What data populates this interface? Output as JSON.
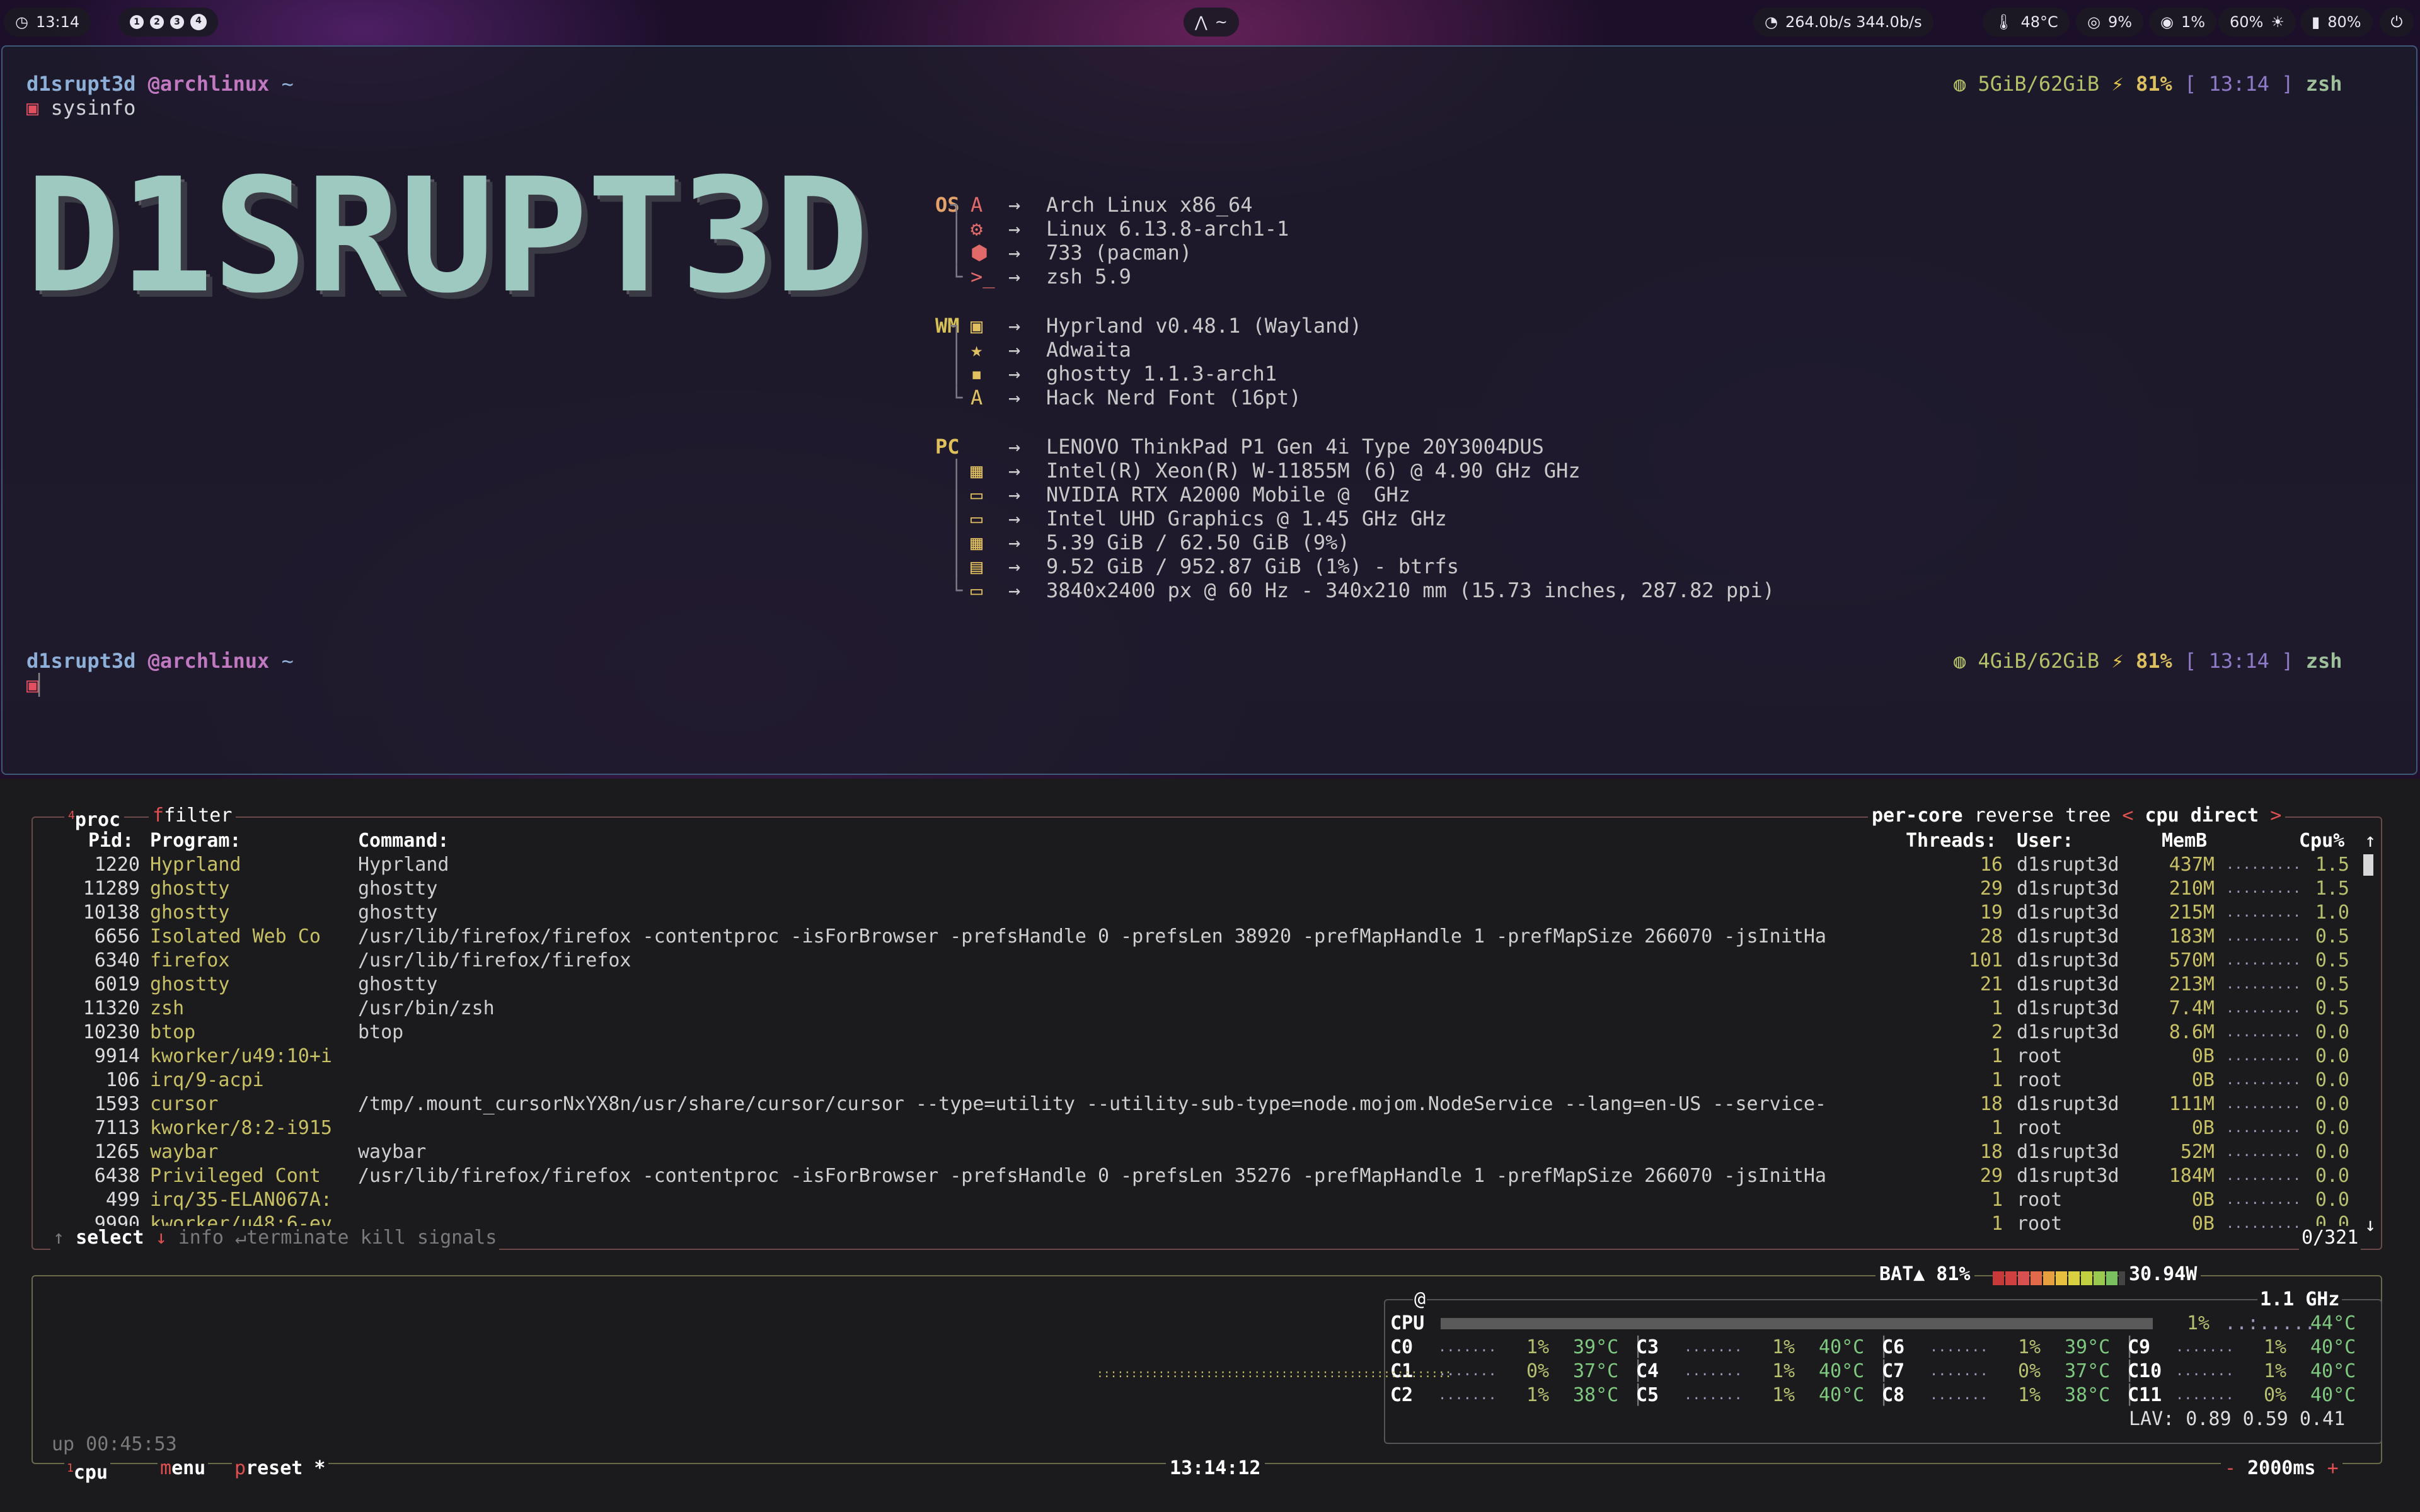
{
  "waybar": {
    "clock": "13:14",
    "workspaces": [
      "1",
      "2",
      "3",
      "4"
    ],
    "launcher": "~",
    "net": "264.0b/s 344.0b/s",
    "temp": "48°C",
    "cpu": "9%",
    "mem": "1%",
    "brightness": "60%",
    "battery": "80%"
  },
  "terminal": {
    "prompt1": {
      "user": "d1srupt3d",
      "host": "@archlinux",
      "dir": "~",
      "mem": "5GiB/62GiB",
      "bat": "81%",
      "time": "13:14",
      "shell": "zsh",
      "command": "sysinfo"
    },
    "prompt2": {
      "user": "d1srupt3d",
      "host": "@archlinux",
      "dir": "~",
      "mem": "4GiB/62GiB",
      "bat": "81%",
      "time": "13:14",
      "shell": "zsh"
    },
    "logo": "D1SRUPT3D",
    "groups": [
      {
        "key": "OS",
        "rows": [
          {
            "icon": "A",
            "value": "Arch Linux x86_64"
          },
          {
            "icon": "⚙",
            "value": "Linux 6.13.8-arch1-1"
          },
          {
            "icon": "⬢",
            "value": "733 (pacman)"
          },
          {
            "icon": ">_",
            "value": "zsh 5.9"
          }
        ]
      },
      {
        "key": "WM",
        "rows": [
          {
            "icon": "▣",
            "value": "Hyprland v0.48.1 (Wayland)"
          },
          {
            "icon": "★",
            "value": "Adwaita"
          },
          {
            "icon": "▪",
            "value": "ghostty 1.1.3-arch1"
          },
          {
            "icon": "A",
            "value": "Hack Nerd Font (16pt)"
          }
        ]
      },
      {
        "key": "PC",
        "rows": [
          {
            "icon": "",
            "value": "LENOVO ThinkPad P1 Gen 4i Type 20Y3004DUS"
          },
          {
            "icon": "▦",
            "value": "Intel(R) Xeon(R) W-11855M (6) @ 4.90 GHz GHz"
          },
          {
            "icon": "▭",
            "value": "NVIDIA RTX A2000 Mobile @  GHz"
          },
          {
            "icon": "▭",
            "value": "Intel UHD Graphics @ 1.45 GHz GHz"
          },
          {
            "icon": "▦",
            "value": "5.39 GiB / 62.50 GiB (9%)"
          },
          {
            "icon": "▤",
            "value": "9.52 GiB / 952.87 GiB (1%) - btrfs"
          },
          {
            "icon": "▭",
            "value": "3840x2400 px @ 60 Hz - 340x210 mm (15.73 inches, 287.82 ppi)"
          }
        ]
      }
    ]
  },
  "proc": {
    "title_num": "4",
    "title": "proc",
    "filter": "filter",
    "per_core": "per-core",
    "reverse": "reverse",
    "tree": "tree",
    "sort": "cpu direct",
    "headers": {
      "pid": "Pid:",
      "program": "Program:",
      "command": "Command:",
      "threads": "Threads:",
      "user": "User:",
      "mem": "MemB",
      "cpu": "Cpu%"
    },
    "rows": [
      {
        "pid": "1220",
        "program": "Hyprland",
        "command": "Hyprland",
        "threads": "16",
        "user": "d1srupt3d",
        "mem": "437M",
        "cpu": "1.5"
      },
      {
        "pid": "11289",
        "program": "ghostty",
        "command": "ghostty",
        "threads": "29",
        "user": "d1srupt3d",
        "mem": "210M",
        "cpu": "1.5"
      },
      {
        "pid": "10138",
        "program": "ghostty",
        "command": "ghostty",
        "threads": "19",
        "user": "d1srupt3d",
        "mem": "215M",
        "cpu": "1.0"
      },
      {
        "pid": "6656",
        "program": "Isolated Web Co",
        "command": "/usr/lib/firefox/firefox -contentproc -isForBrowser -prefsHandle 0 -prefsLen 38920 -prefMapHandle 1 -prefMapSize 266070 -jsInitHa",
        "threads": "28",
        "user": "d1srupt3d",
        "mem": "183M",
        "cpu": "0.5"
      },
      {
        "pid": "6340",
        "program": "firefox",
        "command": "/usr/lib/firefox/firefox",
        "threads": "101",
        "user": "d1srupt3d",
        "mem": "570M",
        "cpu": "0.5"
      },
      {
        "pid": "6019",
        "program": "ghostty",
        "command": "ghostty",
        "threads": "21",
        "user": "d1srupt3d",
        "mem": "213M",
        "cpu": "0.5"
      },
      {
        "pid": "11320",
        "program": "zsh",
        "command": "/usr/bin/zsh",
        "threads": "1",
        "user": "d1srupt3d",
        "mem": "7.4M",
        "cpu": "0.5"
      },
      {
        "pid": "10230",
        "program": "btop",
        "command": "btop",
        "threads": "2",
        "user": "d1srupt3d",
        "mem": "8.6M",
        "cpu": "0.0"
      },
      {
        "pid": "9914",
        "program": "kworker/u49:10+i",
        "command": "",
        "threads": "1",
        "user": "root",
        "mem": "0B",
        "cpu": "0.0"
      },
      {
        "pid": "106",
        "program": "irq/9-acpi",
        "command": "",
        "threads": "1",
        "user": "root",
        "mem": "0B",
        "cpu": "0.0"
      },
      {
        "pid": "1593",
        "program": "cursor",
        "command": "/tmp/.mount_cursorNxYX8n/usr/share/cursor/cursor --type=utility --utility-sub-type=node.mojom.NodeService --lang=en-US --service-",
        "threads": "18",
        "user": "d1srupt3d",
        "mem": "111M",
        "cpu": "0.0"
      },
      {
        "pid": "7113",
        "program": "kworker/8:2-i915",
        "command": "",
        "threads": "1",
        "user": "root",
        "mem": "0B",
        "cpu": "0.0"
      },
      {
        "pid": "1265",
        "program": "waybar",
        "command": "waybar",
        "threads": "18",
        "user": "d1srupt3d",
        "mem": "52M",
        "cpu": "0.0"
      },
      {
        "pid": "6438",
        "program": "Privileged Cont",
        "command": "/usr/lib/firefox/firefox -contentproc -isForBrowser -prefsHandle 0 -prefsLen 35276 -prefMapHandle 1 -prefMapSize 266070 -jsInitHa",
        "threads": "29",
        "user": "d1srupt3d",
        "mem": "184M",
        "cpu": "0.0"
      },
      {
        "pid": "499",
        "program": "irq/35-ELAN067A:",
        "command": "",
        "threads": "1",
        "user": "root",
        "mem": "0B",
        "cpu": "0.0"
      },
      {
        "pid": "9990",
        "program": "kworker/u48:6-ev",
        "command": "",
        "threads": "1",
        "user": "root",
        "mem": "0B",
        "cpu": "0.0"
      }
    ],
    "footer": {
      "select": "select",
      "info": "info",
      "terminate": "terminate",
      "kill": "kill",
      "signals": "signals",
      "count": "0/321"
    }
  },
  "cpu": {
    "bat_label": "BAT▲ 81%",
    "watts": "30.94W",
    "freq": "1.1 GHz",
    "total_label": "CPU",
    "total_pct": "1%",
    "total_temp": "44°C",
    "cores": [
      {
        "name": "C0",
        "pct": "1%",
        "temp": "39°C"
      },
      {
        "name": "C1",
        "pct": "0%",
        "temp": "37°C"
      },
      {
        "name": "C2",
        "pct": "1%",
        "temp": "38°C"
      },
      {
        "name": "C3",
        "pct": "1%",
        "temp": "40°C"
      },
      {
        "name": "C4",
        "pct": "1%",
        "temp": "40°C"
      },
      {
        "name": "C5",
        "pct": "1%",
        "temp": "40°C"
      },
      {
        "name": "C6",
        "pct": "1%",
        "temp": "39°C"
      },
      {
        "name": "C7",
        "pct": "0%",
        "temp": "37°C"
      },
      {
        "name": "C8",
        "pct": "1%",
        "temp": "38°C"
      },
      {
        "name": "C9",
        "pct": "1%",
        "temp": "40°C"
      },
      {
        "name": "C10",
        "pct": "1%",
        "temp": "40°C"
      },
      {
        "name": "C11",
        "pct": "0%",
        "temp": "40°C"
      }
    ],
    "lav": "LAV: 0.89 0.59 0.41",
    "uptime": "up 00:45:53",
    "tabs": {
      "num": "1",
      "cpu": "cpu",
      "menu": "menu",
      "preset": "preset *"
    },
    "clock": "13:14:12",
    "interval": "2000ms",
    "minus": "-",
    "plus": "+",
    "at": "@"
  }
}
